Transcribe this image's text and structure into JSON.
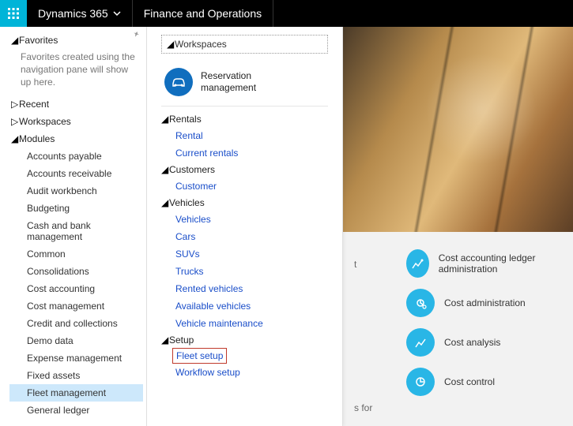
{
  "header": {
    "brand": "Dynamics 365",
    "product": "Finance and Operations"
  },
  "sidebar": {
    "favorites": {
      "label": "Favorites",
      "help": "Favorites created using the navigation pane will show up here."
    },
    "recent": {
      "label": "Recent"
    },
    "workspaces": {
      "label": "Workspaces"
    },
    "modules": {
      "label": "Modules",
      "items": [
        "Accounts payable",
        "Accounts receivable",
        "Audit workbench",
        "Budgeting",
        "Cash and bank management",
        "Common",
        "Consolidations",
        "Cost accounting",
        "Cost management",
        "Credit and collections",
        "Demo data",
        "Expense management",
        "Fixed assets",
        "Fleet management",
        "General ledger"
      ],
      "selected": "Fleet management"
    }
  },
  "flyout": {
    "workspaces": {
      "label": "Workspaces",
      "item": "Reservation management"
    },
    "rentals": {
      "label": "Rentals",
      "items": [
        "Rental",
        "Current rentals"
      ]
    },
    "customers": {
      "label": "Customers",
      "items": [
        "Customer"
      ]
    },
    "vehicles": {
      "label": "Vehicles",
      "items": [
        "Vehicles",
        "Cars",
        "SUVs",
        "Trucks",
        "Rented vehicles",
        "Available vehicles",
        "Vehicle maintenance"
      ]
    },
    "setup": {
      "label": "Setup",
      "items": [
        "Fleet setup",
        "Workflow setup"
      ],
      "highlighted": "Fleet setup"
    }
  },
  "right": {
    "fragments": {
      "a": "t",
      "b": "s for"
    },
    "tiles": {
      "items": [
        "Cost accounting ledger administration",
        "Cost administration",
        "Cost analysis",
        "Cost control"
      ]
    }
  }
}
